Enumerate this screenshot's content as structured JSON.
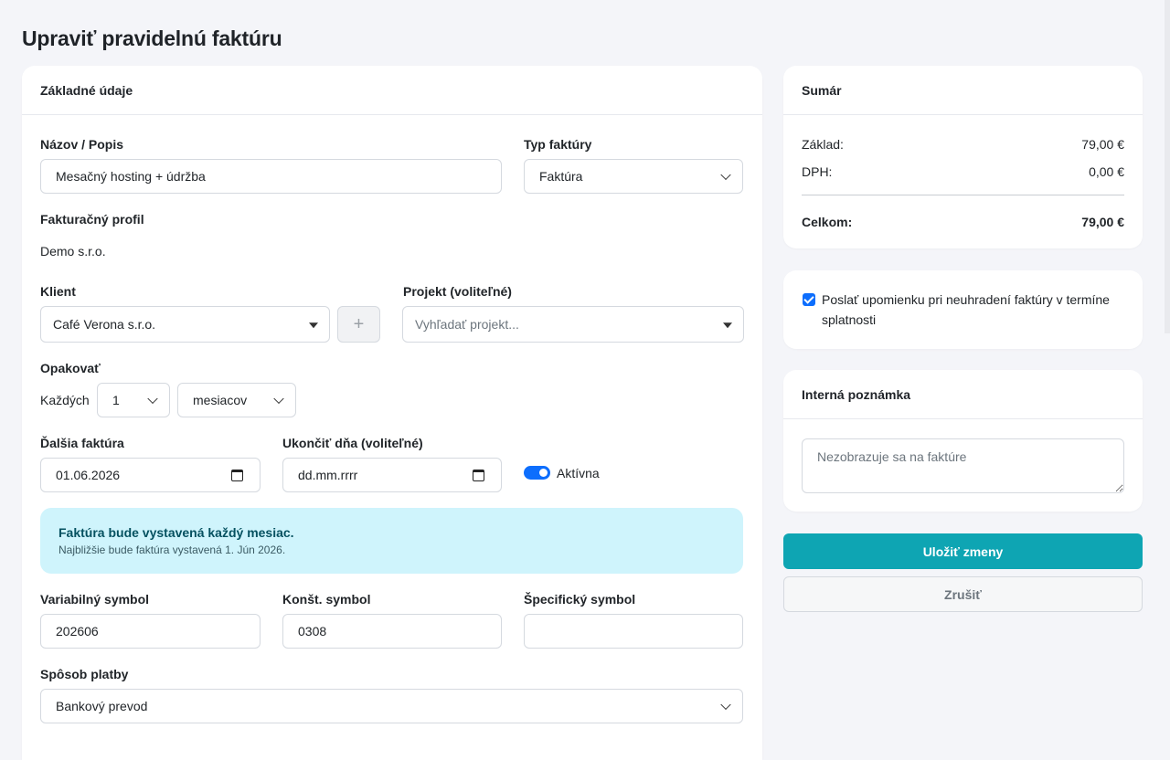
{
  "page_title": "Upraviť pravidelnú faktúru",
  "main": {
    "header": "Základné údaje",
    "name_label": "Názov / Popis",
    "name_value": "Mesačný hosting + údržba",
    "type_label": "Typ faktúry",
    "type_value": "Faktúra",
    "profile_label": "Fakturačný profil",
    "profile_value": "Demo s.r.o.",
    "client_label": "Klient",
    "client_value": "Café Verona s.r.o.",
    "add_client_symbol": "+",
    "project_label": "Projekt (voliteľné)",
    "project_placeholder": "Vyhľadať projekt...",
    "repeat_label": "Opakovať",
    "every_label": "Každých",
    "every_value": "1",
    "unit_value": "mesiacov",
    "next_label": "Ďalšia faktúra",
    "next_value": "01.06.2026",
    "end_label": "Ukončiť dňa (voliteľné)",
    "end_value": "dd.mm.rrrr",
    "active_label": "Aktívna",
    "info_title": "Faktúra bude vystavená každý mesiac.",
    "info_sub": "Najbližšie bude faktúra vystavená 1. Jún 2026.",
    "vs_label": "Variabilný symbol",
    "vs_value": "202606",
    "ks_label": "Konšt. symbol",
    "ks_value": "0308",
    "ss_label": "Špecifický symbol",
    "ss_value": "",
    "payment_label": "Spôsob platby",
    "payment_value": "Bankový prevod"
  },
  "summary": {
    "header": "Sumár",
    "base_label": "Základ:",
    "base_value": "79,00 €",
    "vat_label": "DPH:",
    "vat_value": "0,00 €",
    "total_label": "Celkom:",
    "total_value": "79,00 €"
  },
  "reminder": {
    "checked": true,
    "label": "Poslať upomienku pri neuhradení faktúry v termíne splatnosti"
  },
  "note": {
    "header": "Interná poznámka",
    "placeholder": "Nezobrazuje sa na faktúre"
  },
  "actions": {
    "save_label": "Uložiť zmeny",
    "cancel_label": "Zrušiť"
  },
  "colors": {
    "accent": "#0ea5b3",
    "primary": "#0d6efd",
    "info_bg": "#cff4fc",
    "page_bg": "#f4f5f9"
  }
}
